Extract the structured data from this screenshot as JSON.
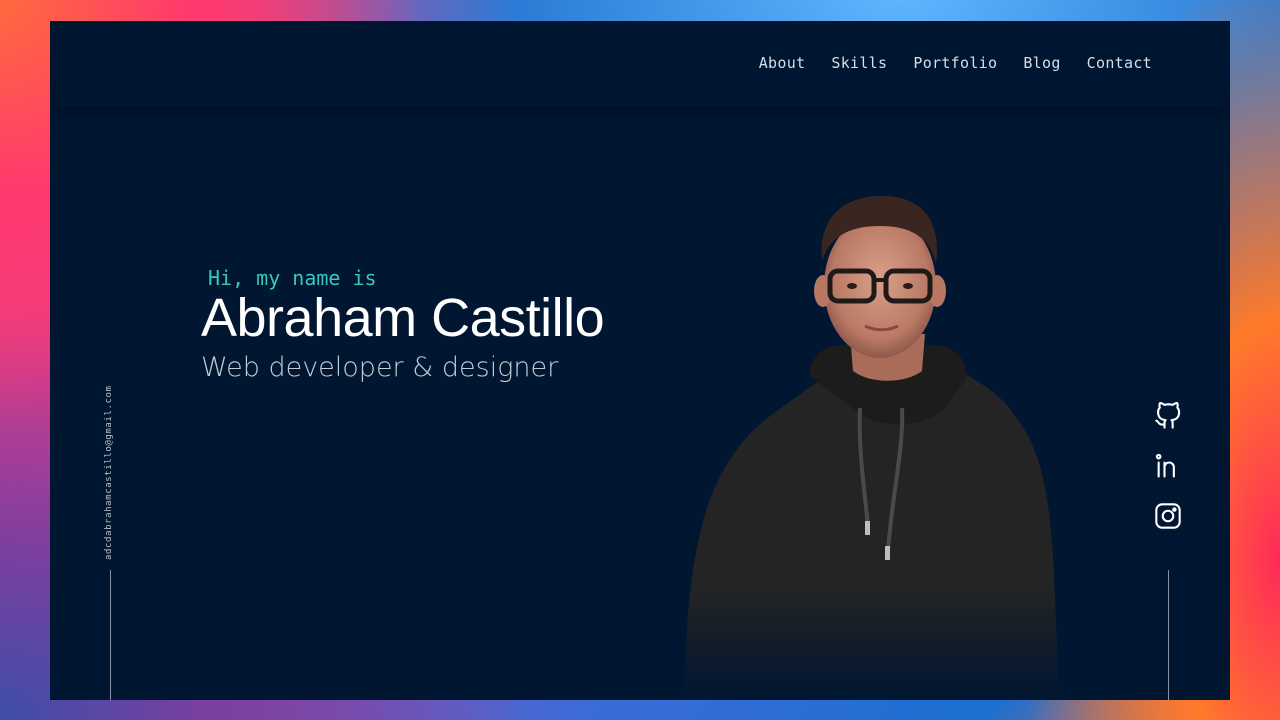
{
  "nav": {
    "items": [
      "About",
      "Skills",
      "Portfolio",
      "Blog",
      "Contact"
    ]
  },
  "hero": {
    "greeting": "Hi, my name is",
    "name": "Abraham Castillo",
    "role": "Web developer & designer"
  },
  "contact": {
    "email": "adcdabrahamcastillo@gmail.com"
  },
  "social": {
    "icons": [
      "github-icon",
      "linkedin-icon",
      "instagram-icon"
    ]
  },
  "colors": {
    "background": "#001631",
    "accent": "#39c8c0",
    "text": "#ffffff",
    "muted": "#c4cad6"
  }
}
